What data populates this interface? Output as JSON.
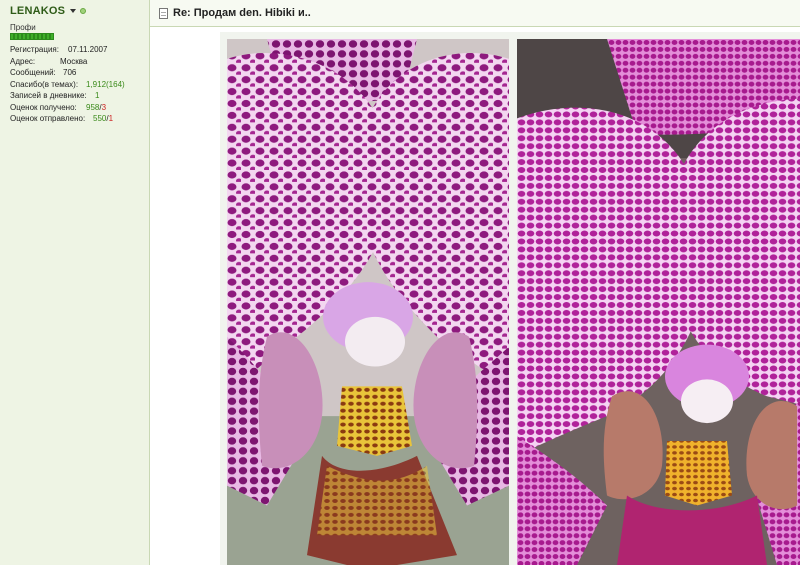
{
  "user": {
    "name": "LENAKOS",
    "rank": "Профи",
    "reputation_pips": 11,
    "stats": [
      {
        "label": "Регистрация:",
        "value": "07.11.2007"
      },
      {
        "label": "Адрес:",
        "value": "Москва"
      },
      {
        "label": "Сообщений:",
        "value": "706"
      },
      {
        "label": "Спасибо(в темах):",
        "value": "1,912(164)"
      },
      {
        "label": "Записей в дневнике:",
        "value": "1"
      },
      {
        "label": "Оценок получено:",
        "value_main": "958",
        "sep": "/",
        "value_neg": "3"
      },
      {
        "label": "Оценок отправлено:",
        "value_main": "550",
        "sep": "/",
        "value_neg": "1"
      }
    ]
  },
  "post": {
    "title": "Re: Продам den. Hibiki и.."
  },
  "icons": {
    "user_menu": "caret-down-icon",
    "status": "online-status-icon",
    "post": "document-icon"
  },
  "colors": {
    "sidebar_bg": "#eef4e4",
    "username": "#2e5b17",
    "positive": "#3a8a1a",
    "negative": "#cc2222"
  }
}
